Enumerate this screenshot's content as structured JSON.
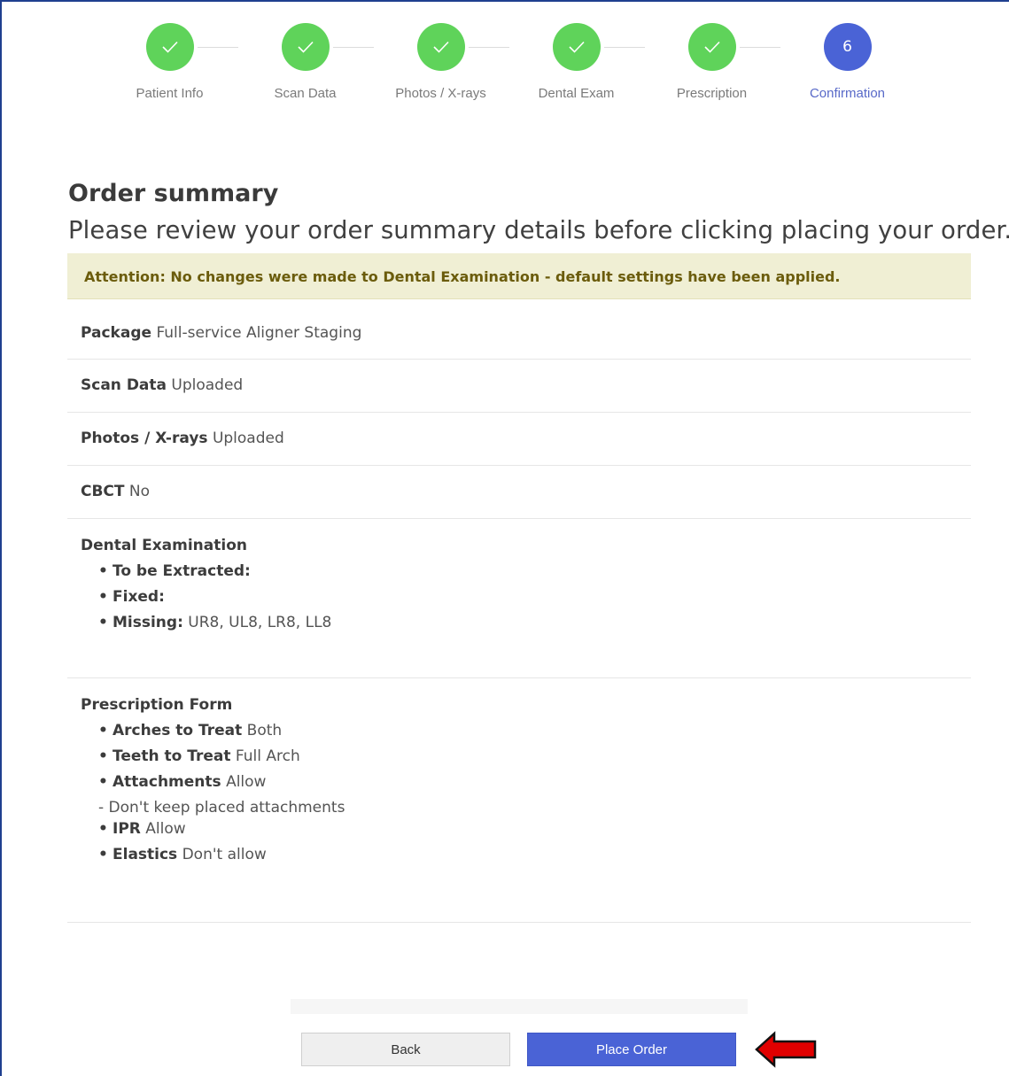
{
  "stepper": {
    "steps": [
      {
        "label": "Patient Info",
        "state": "done"
      },
      {
        "label": "Scan Data",
        "state": "done"
      },
      {
        "label": "Photos / X-rays",
        "state": "done"
      },
      {
        "label": "Dental Exam",
        "state": "done"
      },
      {
        "label": "Prescription",
        "state": "done"
      },
      {
        "label": "Confirmation",
        "state": "active",
        "number": "6"
      }
    ],
    "done_icon": "check-icon"
  },
  "page": {
    "title": "Order summary",
    "subtitle": "Please review your order summary details before clicking placing your order."
  },
  "alert": {
    "text": "Attention: No changes were made to Dental Examination - default settings have been applied."
  },
  "summary": {
    "package": {
      "key": "Package",
      "value": "Full-service Aligner Staging"
    },
    "scan_data": {
      "key": "Scan Data",
      "value": "Uploaded"
    },
    "photos": {
      "key": "Photos / X-rays",
      "value": "Uploaded"
    },
    "cbct": {
      "key": "CBCT",
      "value": "No"
    },
    "dental_exam": {
      "title": "Dental Examination",
      "items": [
        {
          "key": "To be Extracted:",
          "value": ""
        },
        {
          "key": "Fixed:",
          "value": ""
        },
        {
          "key": "Missing:",
          "value": "UR8, UL8, LR8, LL8"
        }
      ]
    },
    "prescription": {
      "title": "Prescription Form",
      "arches": {
        "key": "Arches to Treat",
        "value": "Both"
      },
      "teeth": {
        "key": "Teeth to Treat",
        "value": "Full Arch"
      },
      "attachments": {
        "key": "Attachments",
        "value": "Allow"
      },
      "attachments_note": "- Don't keep placed attachments",
      "ipr": {
        "key": "IPR",
        "value": "Allow"
      },
      "elastics": {
        "key": "Elastics",
        "value": "Don't allow"
      }
    }
  },
  "actions": {
    "back_label": "Back",
    "place_order_label": "Place Order"
  },
  "colors": {
    "step_done": "#5fd35a",
    "step_active": "#4a63d6",
    "primary_button": "#4a63d6",
    "annotation_arrow": "#e00000"
  }
}
